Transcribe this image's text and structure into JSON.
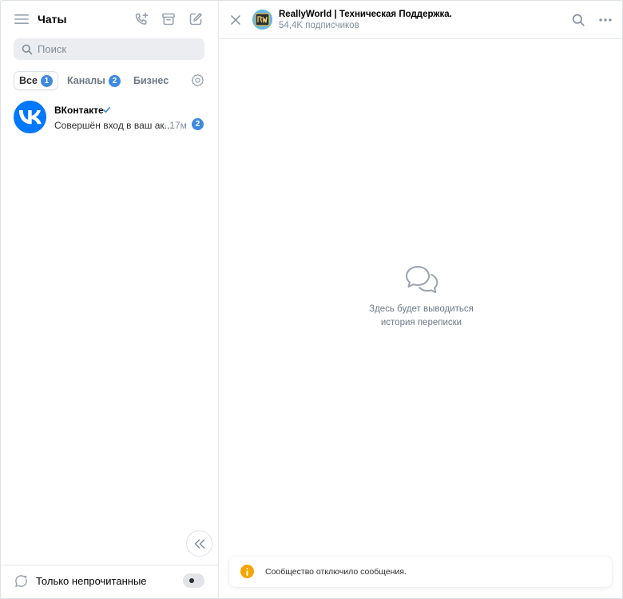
{
  "left": {
    "title": "Чаты",
    "search_placeholder": "Поиск",
    "filters": [
      {
        "label": "Все",
        "count": "1",
        "active": true
      },
      {
        "label": "Каналы",
        "count": "2",
        "active": false
      },
      {
        "label": "Бизнес",
        "count": "",
        "active": false
      }
    ],
    "chats": [
      {
        "name": "ВКонтакте",
        "preview": "Совершён вход в ваш ак...",
        "time": "· 17м",
        "unread": "2",
        "avatar_color": "#0077ff"
      }
    ],
    "unread_only_label": "Только непрочитанные"
  },
  "conversation": {
    "title": "ReallyWorld | Техническая Поддержка.",
    "subtitle": "54,4K подписчиков",
    "empty_line1": "Здесь будет выводиться",
    "empty_line2": "история переписки",
    "notice": "Сообщество отключило сообщения."
  },
  "colors": {
    "accent": "#3f8ae0",
    "vk_blue": "#0077ff",
    "warning": "#f6a400"
  },
  "icons": [
    "menu-icon",
    "add-call-icon",
    "archive-icon",
    "compose-icon",
    "search-icon",
    "settings-icon",
    "verified-icon",
    "collapse-icon",
    "unread-icon",
    "close-icon",
    "more-icon",
    "chats-empty-icon",
    "info-icon"
  ]
}
